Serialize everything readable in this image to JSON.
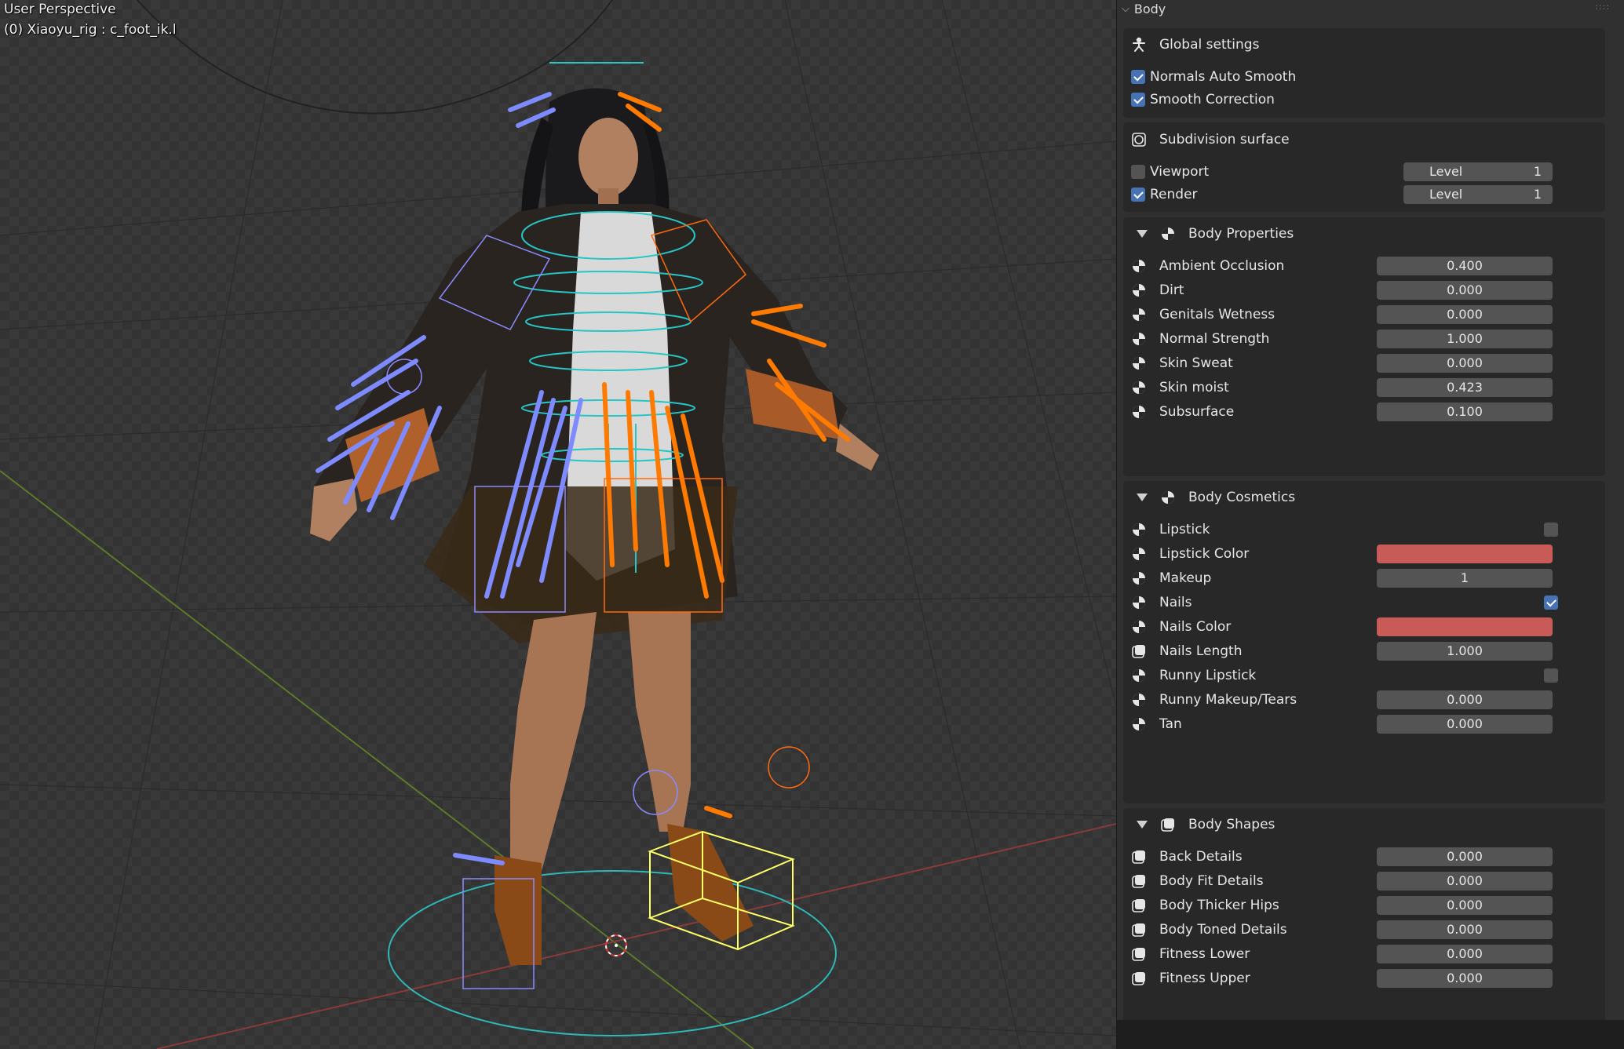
{
  "viewport": {
    "title": "User Perspective",
    "object_label": "(0) Xiaoyu_rig : c_foot_ik.l"
  },
  "panel": {
    "header": "Body",
    "global_settings": {
      "title": "Global settings",
      "normals_auto_smooth": {
        "label": "Normals Auto Smooth",
        "checked": true
      },
      "smooth_correction": {
        "label": "Smooth Correction",
        "checked": true
      }
    },
    "subdivision": {
      "title": "Subdivision surface",
      "viewport": {
        "label": "Viewport",
        "checked": false,
        "level_label": "Level",
        "level": "1"
      },
      "render": {
        "label": "Render",
        "checked": true,
        "level_label": "Level",
        "level": "1"
      }
    },
    "body_properties": {
      "title": "Body Properties",
      "items": [
        {
          "label": "Ambient Occlusion",
          "value": "0.400"
        },
        {
          "label": "Dirt",
          "value": "0.000"
        },
        {
          "label": "Genitals Wetness",
          "value": "0.000"
        },
        {
          "label": "Normal Strength",
          "value": "1.000"
        },
        {
          "label": "Skin Sweat",
          "value": "0.000"
        },
        {
          "label": "Skin moist",
          "value": "0.423"
        },
        {
          "label": "Subsurface",
          "value": "0.100"
        }
      ]
    },
    "body_cosmetics": {
      "title": "Body Cosmetics",
      "lipstick": {
        "label": "Lipstick",
        "checked": false
      },
      "lipstick_color": {
        "label": "Lipstick Color",
        "color": "#c85a57"
      },
      "makeup": {
        "label": "Makeup",
        "value": "1"
      },
      "nails": {
        "label": "Nails",
        "checked": true
      },
      "nails_color": {
        "label": "Nails Color",
        "color": "#c85a57"
      },
      "nails_length": {
        "label": "Nails Length",
        "value": "1.000"
      },
      "runny_lipstick": {
        "label": "Runny Lipstick",
        "checked": false
      },
      "runny_makeup": {
        "label": "Runny Makeup/Tears",
        "value": "0.000"
      },
      "tan": {
        "label": "Tan",
        "value": "0.000"
      }
    },
    "body_shapes": {
      "title": "Body Shapes",
      "items": [
        {
          "label": "Back Details",
          "value": "0.000"
        },
        {
          "label": "Body Fit Details",
          "value": "0.000"
        },
        {
          "label": "Body Thicker Hips",
          "value": "0.000"
        },
        {
          "label": "Body Toned Details",
          "value": "0.000"
        },
        {
          "label": "Fitness Lower",
          "value": "0.000"
        },
        {
          "label": "Fitness Upper",
          "value": "0.000"
        }
      ]
    }
  },
  "colors": {
    "accent_blue": "#4772b3",
    "ik_orange": "#ff7a00",
    "ik_blue": "#7e8bff",
    "cyan": "#26c6c6",
    "selected_yellow": "#ffff66"
  }
}
